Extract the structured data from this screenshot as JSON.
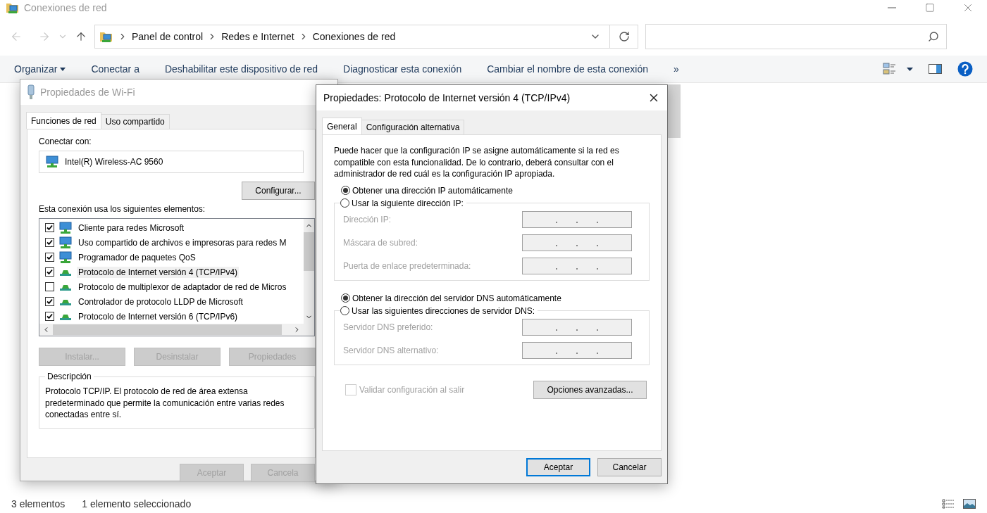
{
  "window": {
    "title": "Conexiones de red"
  },
  "breadcrumb": [
    "Panel de control",
    "Redes e Internet",
    "Conexiones de red"
  ],
  "toolbar": {
    "items": [
      {
        "label": "Organizar",
        "kind": "menu"
      },
      {
        "label": "Conectar a",
        "kind": "plain"
      },
      {
        "label": "Deshabilitar este dispositivo de red",
        "kind": "plain"
      },
      {
        "label": "Diagnosticar esta conexión",
        "kind": "plain"
      },
      {
        "label": "Cambiar el nombre de esta conexión",
        "kind": "plain"
      }
    ],
    "overflow": "»"
  },
  "status_bar": {
    "items": [
      "3 elementos",
      "1 elemento seleccionado"
    ]
  },
  "wifi_dialog": {
    "title": "Propiedades de Wi-Fi",
    "tabs": [
      {
        "label": "Funciones de red",
        "selected": true
      },
      {
        "label": "Uso compartido",
        "selected": false
      }
    ],
    "connect_label": "Conectar con:",
    "adapter": "Intel(R) Wireless-AC 9560",
    "configure_button": "Configurar...",
    "elements_label": "Esta conexión usa los siguientes elementos:",
    "elements": [
      {
        "label": "Cliente para redes Microsoft",
        "kind": "service",
        "checked": true,
        "selected": false
      },
      {
        "label": "Uso compartido de archivos e impresoras para redes M",
        "kind": "service",
        "checked": true,
        "selected": false
      },
      {
        "label": "Programador de paquetes QoS",
        "kind": "service",
        "checked": true,
        "selected": false
      },
      {
        "label": "Protocolo de Internet versión 4 (TCP/IPv4)",
        "kind": "protocol",
        "checked": true,
        "selected": true
      },
      {
        "label": "Protocolo de multiplexor de adaptador de red de Micros",
        "kind": "protocol",
        "checked": false,
        "selected": false
      },
      {
        "label": "Controlador de protocolo LLDP de Microsoft",
        "kind": "protocol",
        "checked": true,
        "selected": false
      },
      {
        "label": "Protocolo de Internet versión 6 (TCP/IPv6)",
        "kind": "protocol",
        "checked": true,
        "selected": false
      }
    ],
    "actions": [
      {
        "label": "Instalar...",
        "disabled": true
      },
      {
        "label": "Desinstalar",
        "disabled": true
      },
      {
        "label": "Propiedades",
        "disabled": true
      }
    ],
    "description_title": "Descripción",
    "description": "Protocolo TCP/IP. El protocolo de red de área extensa predeterminado que permite la comunicación entre varias redes conectadas entre sí.",
    "footer_buttons": [
      {
        "label": "Aceptar",
        "disabled": true
      },
      {
        "label": "Cancela",
        "disabled": true
      }
    ]
  },
  "ipv4_dialog": {
    "title": "Propiedades: Protocolo de Internet versión 4 (TCP/IPv4)",
    "tabs": [
      {
        "label": "General",
        "selected": true
      },
      {
        "label": "Configuración alternativa",
        "selected": false
      }
    ],
    "intro": "Puede hacer que la configuración IP se asigne automáticamente si la red es compatible con esta funcionalidad. De lo contrario, deberá consultar con el administrador de red cuál es la configuración IP apropiada.",
    "sections": [
      {
        "auto_option": {
          "label": "Obtener una dirección IP automáticamente",
          "selected": true
        },
        "manual_option": {
          "label": "Usar la siguiente dirección IP:",
          "selected": false
        },
        "fields": [
          {
            "label": "Dirección IP:",
            "disabled": true
          },
          {
            "label": "Máscara de subred:",
            "disabled": true
          },
          {
            "label": "Puerta de enlace predeterminada:",
            "disabled": true
          }
        ]
      },
      {
        "auto_option": {
          "label": "Obtener la dirección del servidor DNS automáticamente",
          "selected": true
        },
        "manual_option": {
          "label": "Usar las siguientes direcciones de servidor DNS:",
          "selected": false
        },
        "fields": [
          {
            "label": "Servidor DNS preferido:",
            "disabled": true
          },
          {
            "label": "Servidor DNS alternativo:",
            "disabled": true
          }
        ]
      }
    ],
    "validate": {
      "label": "Validar configuración al salir",
      "checked": false,
      "disabled": true
    },
    "advanced_button": "Opciones avanzadas...",
    "footer_buttons": [
      {
        "label": "Aceptar",
        "default": true
      },
      {
        "label": "Cancelar",
        "default": false
      }
    ]
  }
}
